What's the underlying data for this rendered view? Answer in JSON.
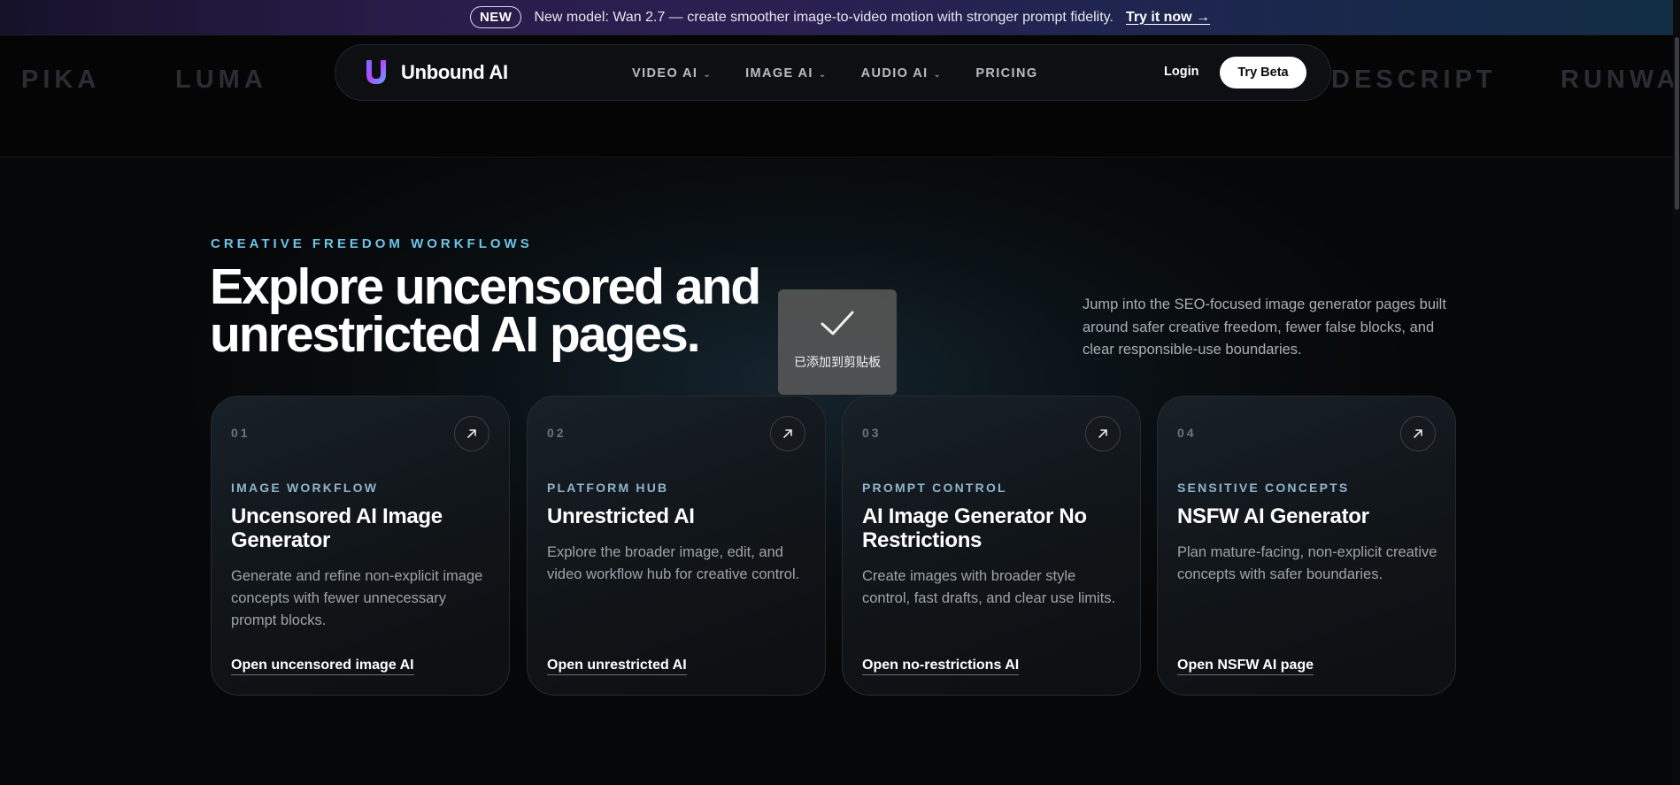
{
  "announcement": {
    "badge": "NEW",
    "message": "New model: Wan 2.7 — create smoother image-to-video motion with stronger prompt fidelity.",
    "cta": "Try it now →"
  },
  "marquee": [
    "PIKA",
    "LUMA",
    "DESCRIPT",
    "RUNWA"
  ],
  "nav": {
    "brand": "Unbound AI",
    "links": [
      {
        "label": "VIDEO AI",
        "has_dropdown": true
      },
      {
        "label": "IMAGE AI",
        "has_dropdown": true
      },
      {
        "label": "AUDIO AI",
        "has_dropdown": true
      },
      {
        "label": "PRICING",
        "has_dropdown": false
      }
    ],
    "dropdown_icon": "chevron-down-icon",
    "login": "Login",
    "try_beta": "Try Beta"
  },
  "hero": {
    "eyebrow": "CREATIVE FREEDOM WORKFLOWS",
    "headline_line1": "Explore uncensored and",
    "headline_line2": "unrestricted AI pages.",
    "side_copy": "Jump into the SEO-focused image generator pages built around safer creative freedom, fewer false blocks, and clear responsible-use boundaries."
  },
  "toast": {
    "icon": "checkmark-icon",
    "text": "已添加到剪贴板"
  },
  "cards": [
    {
      "number": "01",
      "kicker": "IMAGE WORKFLOW",
      "title": "Uncensored AI Image Generator",
      "description": "Generate and refine non-explicit image concepts with fewer unnecessary prompt blocks.",
      "link": "Open uncensored image AI"
    },
    {
      "number": "02",
      "kicker": "PLATFORM HUB",
      "title": "Unrestricted AI",
      "description": "Explore the broader image, edit, and video workflow hub for creative control.",
      "link": "Open unrestricted AI"
    },
    {
      "number": "03",
      "kicker": "PROMPT CONTROL",
      "title": "AI Image Generator No Restrictions",
      "description": "Create images with broader style control, fast drafts, and clear use limits.",
      "link": "Open no-restrictions AI"
    },
    {
      "number": "04",
      "kicker": "SENSITIVE CONCEPTS",
      "title": "NSFW AI Generator",
      "description": "Plan mature-facing, non-explicit creative concepts with safer boundaries.",
      "link": "Open NSFW AI page"
    }
  ],
  "colors": {
    "accent_eyebrow": "#6ec4e8",
    "card_kicker": "#8fb4cc",
    "background": "#060708"
  }
}
